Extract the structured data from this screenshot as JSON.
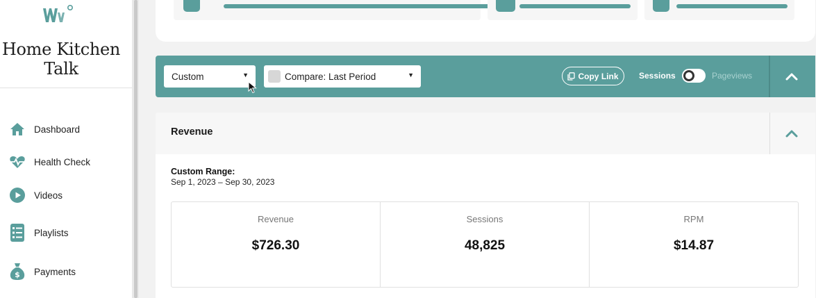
{
  "sidebar": {
    "site_name": "Home Kitchen Talk",
    "items": [
      {
        "label": "Dashboard",
        "icon": "home-icon"
      },
      {
        "label": "Health Check",
        "icon": "heart-pulse-icon"
      },
      {
        "label": "Videos",
        "icon": "play-circle-icon"
      },
      {
        "label": "Playlists",
        "icon": "list-icon"
      },
      {
        "label": "Payments",
        "icon": "money-bag-icon"
      }
    ]
  },
  "filter_bar": {
    "date_select": "Custom",
    "compare_select": "Compare: Last Period",
    "copy_link": "Copy Link",
    "toggle_left": "Sessions",
    "toggle_right": "Pageviews"
  },
  "revenue": {
    "title": "Revenue",
    "range_label": "Custom Range:",
    "range_dates": "Sep 1, 2023 – Sep 30, 2023",
    "metrics": [
      {
        "label": "Revenue",
        "value": "$726.30"
      },
      {
        "label": "Sessions",
        "value": "48,825"
      },
      {
        "label": "RPM",
        "value": "$14.87"
      }
    ]
  },
  "colors": {
    "accent": "#5a9e9c",
    "background": "#f2f2f2"
  }
}
